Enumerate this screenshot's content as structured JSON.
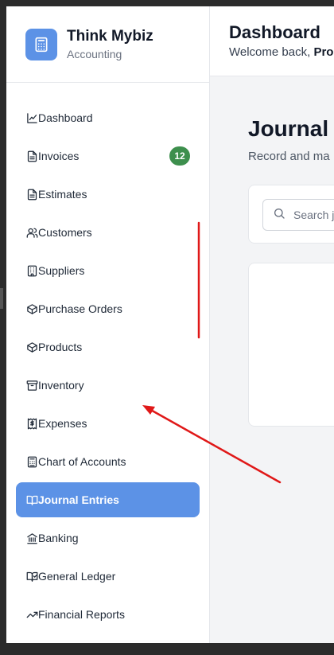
{
  "brand": {
    "name": "Think Mybiz",
    "subtitle": "Accounting",
    "icon": "calculator-icon"
  },
  "sidebar": {
    "items": [
      {
        "label": "Dashboard",
        "icon": "chart-line-icon"
      },
      {
        "label": "Invoices",
        "icon": "file-text-icon",
        "badge": "12"
      },
      {
        "label": "Estimates",
        "icon": "file-text-icon"
      },
      {
        "label": "Customers",
        "icon": "users-icon"
      },
      {
        "label": "Suppliers",
        "icon": "building-icon"
      },
      {
        "label": "Purchase Orders",
        "icon": "package-icon"
      },
      {
        "label": "Products",
        "icon": "package-icon"
      },
      {
        "label": "Inventory",
        "icon": "archive-icon"
      },
      {
        "label": "Expenses",
        "icon": "receipt-dollar-icon"
      },
      {
        "label": "Chart of Accounts",
        "icon": "calculator-icon"
      },
      {
        "label": "Journal Entries",
        "icon": "book-open-icon",
        "active": true
      },
      {
        "label": "Banking",
        "icon": "landmark-icon"
      },
      {
        "label": "General Ledger",
        "icon": "book-check-icon"
      },
      {
        "label": "Financial Reports",
        "icon": "trending-up-icon"
      }
    ]
  },
  "header": {
    "title": "Dashboard",
    "welcome_prefix": "Welcome back, ",
    "welcome_name": "Pro"
  },
  "main": {
    "page_title": "Journal",
    "page_subtitle": "Record and ma",
    "search_placeholder": "Search jo"
  },
  "colors": {
    "accent": "#5c92e6",
    "badge": "#3d8f4d",
    "annotation": "#e01818"
  }
}
